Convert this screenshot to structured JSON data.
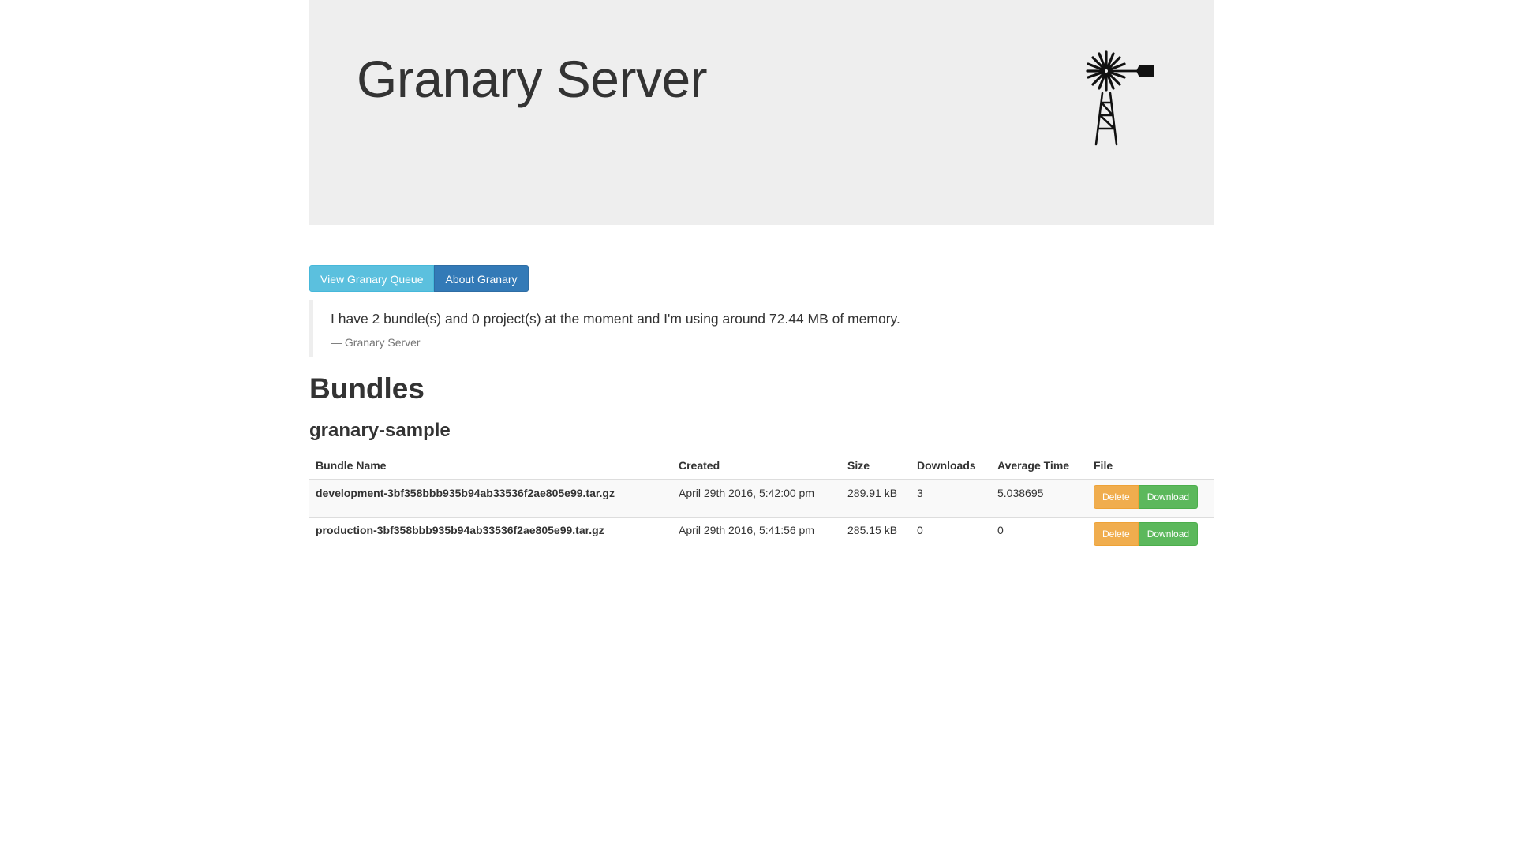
{
  "header": {
    "title": "Granary Server",
    "logo_icon": "windmill-icon"
  },
  "nav": {
    "queue_label": "View Granary Queue",
    "about_label": "About Granary"
  },
  "status": {
    "message": "I have 2 bundle(s) and 0 project(s) at the moment and I'm using around 72.44 MB of memory.",
    "source": "Granary Server"
  },
  "bundles": {
    "heading": "Bundles",
    "project": "granary-sample",
    "columns": [
      "Bundle Name",
      "Created",
      "Size",
      "Downloads",
      "Average Time",
      "File"
    ],
    "rows": [
      {
        "name": "development-3bf358bbb935b94ab33536f2ae805e99.tar.gz",
        "created": "April 29th 2016, 5:42:00 pm",
        "size": "289.91 kB",
        "downloads": "3",
        "avg_time": "5.038695",
        "delete_label": "Delete",
        "download_label": "Download"
      },
      {
        "name": "production-3bf358bbb935b94ab33536f2ae805e99.tar.gz",
        "created": "April 29th 2016, 5:41:56 pm",
        "size": "285.15 kB",
        "downloads": "0",
        "avg_time": "0",
        "delete_label": "Delete",
        "download_label": "Download"
      }
    ]
  },
  "colors": {
    "jumbotron_bg": "#eeeeee",
    "info": "#5bc0de",
    "primary": "#337ab7",
    "warning": "#f0ad4e",
    "success": "#5cb85c"
  }
}
